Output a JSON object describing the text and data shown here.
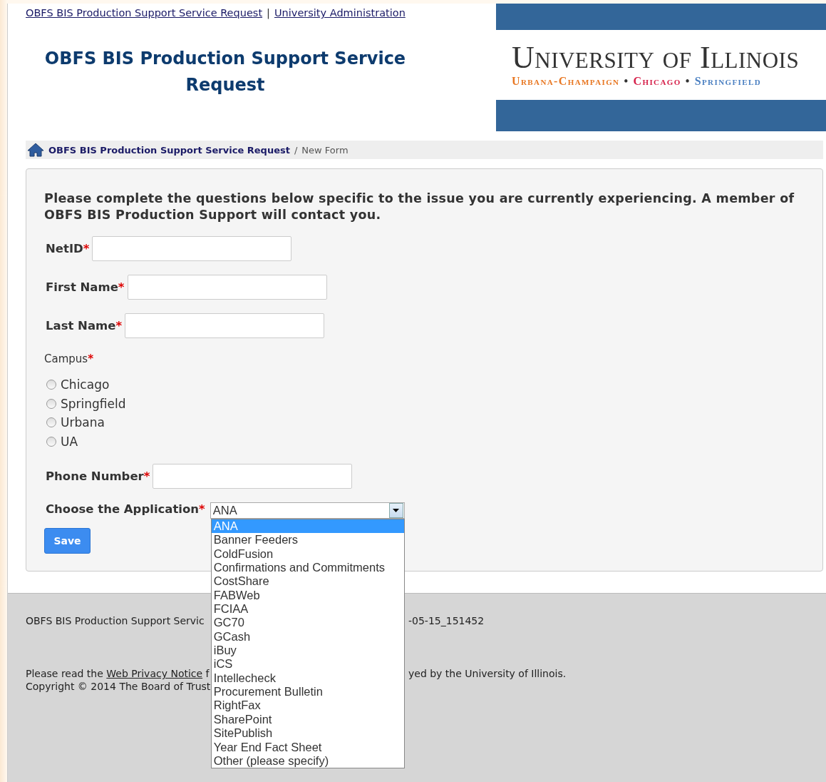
{
  "top_links": {
    "items": [
      "OBFS BIS Production Support Service Request",
      "University Administration"
    ],
    "separator": "|"
  },
  "title": "OBFS BIS Production Support Service Request",
  "logo": {
    "name": "University of Illinois",
    "separator": "•",
    "campuses": [
      {
        "label": "Urbana-Champaign",
        "color": "#e87722"
      },
      {
        "label": "Chicago",
        "color": "#d6204a"
      },
      {
        "label": "Springfield",
        "color": "#4a7fc1"
      }
    ]
  },
  "breadcrumb": {
    "items": [
      "OBFS BIS Production Support Service Request",
      "New Form"
    ],
    "separator": "/"
  },
  "form": {
    "intro": "Please complete the questions below specific to the issue you are currently experiencing. A member of OBFS BIS Production Support will contact you.",
    "required_mark": "*",
    "fields": [
      {
        "kind": "text",
        "label": "NetID",
        "required": true
      },
      {
        "kind": "text",
        "label": "First Name",
        "required": true
      },
      {
        "kind": "text",
        "label": "Last Name",
        "required": true
      },
      {
        "kind": "radio",
        "label": "Campus",
        "required": true,
        "options": [
          {
            "label": "Chicago",
            "selected": false
          },
          {
            "label": "Springfield",
            "selected": false
          },
          {
            "label": "Urbana",
            "selected": false
          },
          {
            "label": "UA",
            "selected": false
          }
        ]
      },
      {
        "kind": "text",
        "label": "Phone Number",
        "required": true
      },
      {
        "kind": "select",
        "label": "Choose the Application",
        "required": true,
        "value": "ANA",
        "expanded": true,
        "options": [
          {
            "label": "ANA",
            "selected": true
          },
          {
            "label": "Banner Feeders",
            "selected": false
          },
          {
            "label": "ColdFusion",
            "selected": false
          },
          {
            "label": "Confirmations and Commitments",
            "selected": false
          },
          {
            "label": "CostShare",
            "selected": false
          },
          {
            "label": "FABWeb",
            "selected": false
          },
          {
            "label": "FCIAA",
            "selected": false
          },
          {
            "label": "GC70",
            "selected": false
          },
          {
            "label": "GCash",
            "selected": false
          },
          {
            "label": "iBuy",
            "selected": false
          },
          {
            "label": "iCS",
            "selected": false
          },
          {
            "label": "Intellecheck",
            "selected": false
          },
          {
            "label": "Procurement Bulletin",
            "selected": false
          },
          {
            "label": "RightFax",
            "selected": false
          },
          {
            "label": "SharePoint",
            "selected": false
          },
          {
            "label": "SitePublish",
            "selected": false
          },
          {
            "label": "Year End Fact Sheet",
            "selected": false
          },
          {
            "label": "Other (please specify)",
            "selected": false
          }
        ]
      }
    ],
    "save_button": "Save"
  },
  "footer": {
    "version_left": "OBFS BIS Production Support Servic",
    "version_right": "-05-15_151452",
    "privacy_prefix": "Please read the ",
    "privacy_link": "Web Privacy Notice",
    "privacy_tail": " f",
    "privacy_right": "yed by the University of Illinois.",
    "copyright": "Copyright © 2014 The Board of Trust"
  }
}
